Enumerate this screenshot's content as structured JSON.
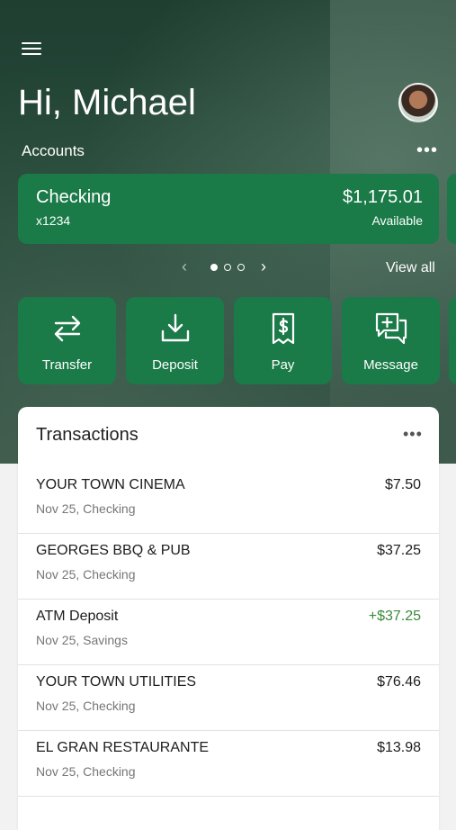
{
  "header": {
    "greeting": "Hi, Michael",
    "accounts_label": "Accounts",
    "more_symbol": "•••"
  },
  "account": {
    "name": "Checking",
    "number": "x1234",
    "balance": "$1,175.01",
    "balance_label": "Available"
  },
  "pager": {
    "prev": "‹",
    "next": "›",
    "view_all": "View all",
    "active_index": 1,
    "total": 3
  },
  "actions": [
    {
      "label": "Transfer",
      "icon": "transfer-icon"
    },
    {
      "label": "Deposit",
      "icon": "deposit-icon"
    },
    {
      "label": "Pay",
      "icon": "pay-icon"
    },
    {
      "label": "Message",
      "icon": "message-icon"
    }
  ],
  "transactions": {
    "title": "Transactions",
    "more_symbol": "•••",
    "items": [
      {
        "name": "YOUR TOWN CINEMA",
        "meta": "Nov 25, Checking",
        "amount": "$7.50",
        "credit": false
      },
      {
        "name": "GEORGES BBQ & PUB",
        "meta": "Nov 25, Checking",
        "amount": "$37.25",
        "credit": false
      },
      {
        "name": "ATM Deposit",
        "meta": "Nov 25, Savings",
        "amount": "+$37.25",
        "credit": true
      },
      {
        "name": "YOUR TOWN UTILITIES",
        "meta": "Nov 25, Checking",
        "amount": "$76.46",
        "credit": false
      },
      {
        "name": "EL GRAN RESTAURANTE",
        "meta": "Nov 25, Checking",
        "amount": "$13.98",
        "credit": false
      }
    ]
  },
  "colors": {
    "brand_green": "#1a7a48",
    "credit_green": "#3a8a3a",
    "hero_dark": "#264a3a"
  }
}
